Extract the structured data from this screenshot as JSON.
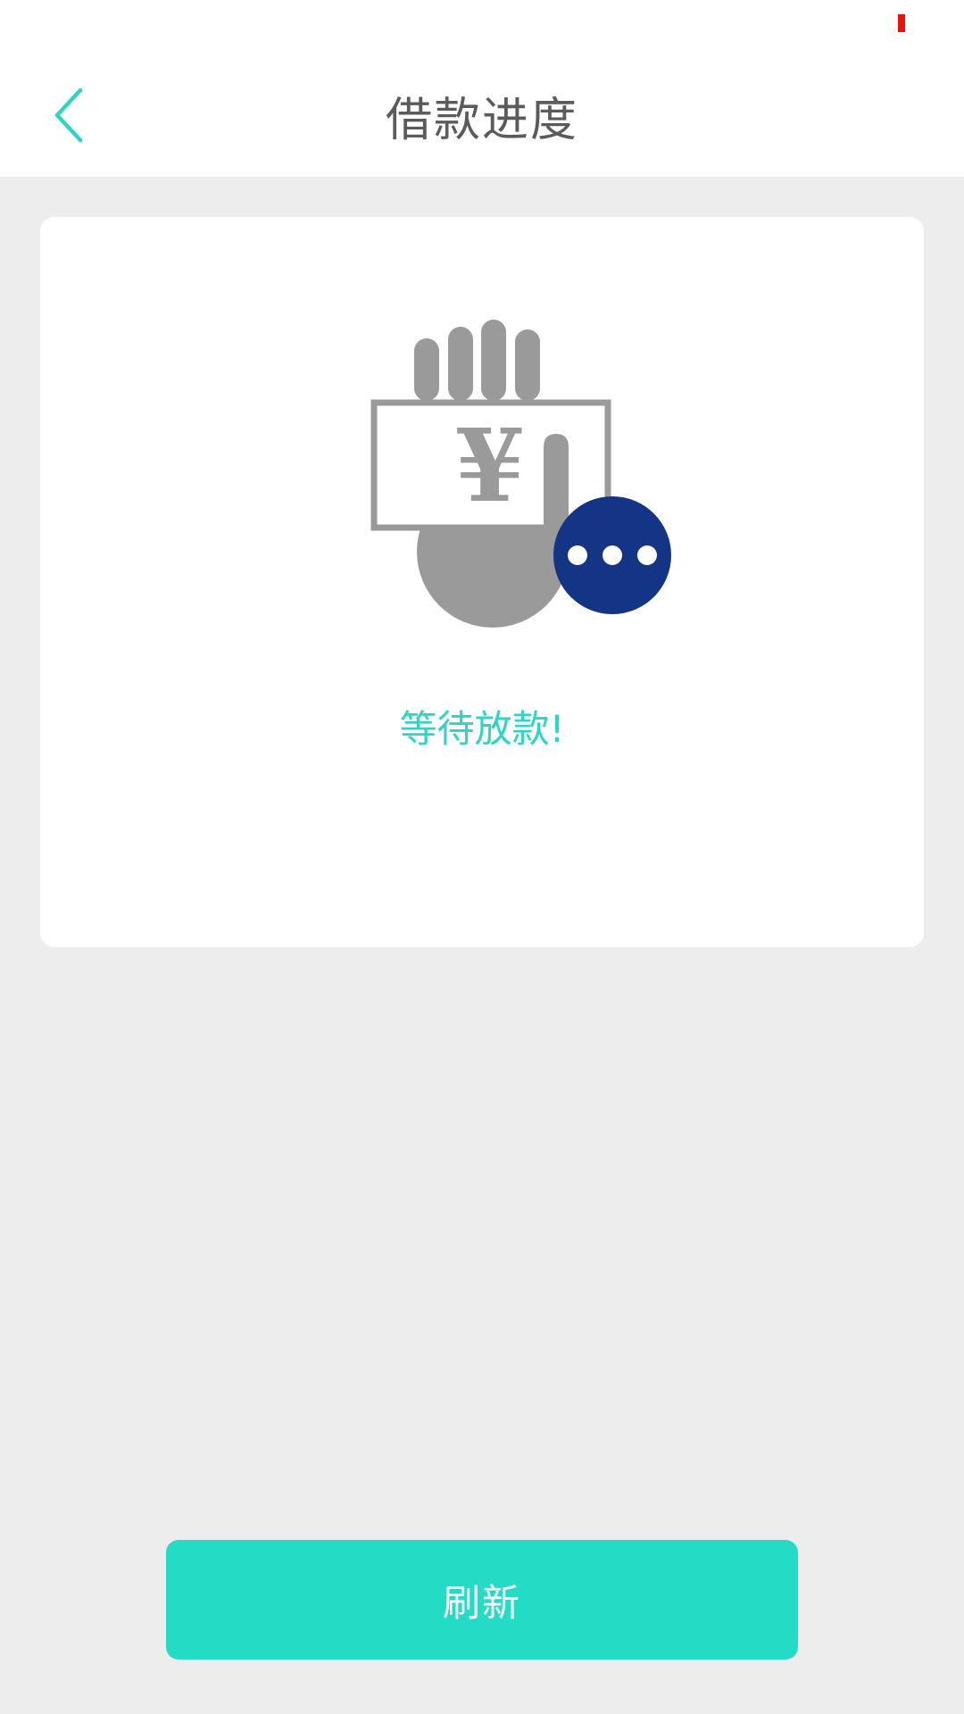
{
  "header": {
    "title": "借款进度",
    "back_icon": "chevron-left-icon"
  },
  "card": {
    "illustration_icon": "hand-holding-yuan-bill-icon",
    "currency_symbol": "¥",
    "pending_icon": "more-dots-icon",
    "status_message": "等待放款!"
  },
  "actions": {
    "refresh_label": "刷新"
  },
  "colors": {
    "accent": "#24dcc6",
    "accent_text": "#2dd5c4",
    "badge": "#143585",
    "illustration_gray": "#9a9a9a",
    "status_indicator": "#e8130f"
  }
}
